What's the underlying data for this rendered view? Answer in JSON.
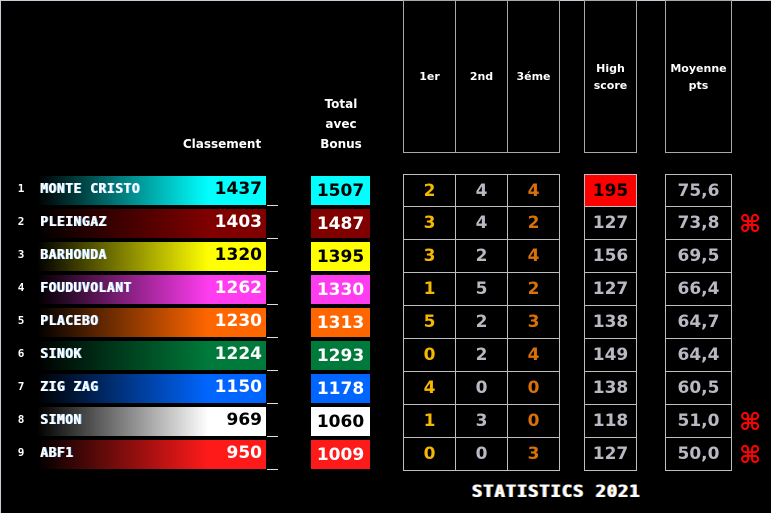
{
  "headers": {
    "classement": "Classement",
    "total_line1": "Total",
    "total_line2": "avec",
    "total_line3": "Bonus",
    "first": "1er",
    "second": "2nd",
    "third": "3éme",
    "highscore_line1": "High",
    "highscore_line2": "score",
    "moyenne_line1": "Moyenne",
    "moyenne_line2": "pts"
  },
  "players": [
    {
      "rank": "1",
      "name": "MONTE CRISTO",
      "score": "1437",
      "total": "1507",
      "first": "2",
      "second": "4",
      "third": "4",
      "highscore": "195",
      "average": "75,6",
      "mark": "",
      "color": "#00ffff",
      "text_color": "#000000",
      "top_highscore": true
    },
    {
      "rank": "2",
      "name": "PLEINGAZ",
      "score": "1403",
      "total": "1487",
      "first": "3",
      "second": "4",
      "third": "2",
      "highscore": "127",
      "average": "73,8",
      "mark": "⌘",
      "color": "#800000",
      "text_color": "#ffffff",
      "top_highscore": false
    },
    {
      "rank": "3",
      "name": "BARHONDA",
      "score": "1320",
      "total": "1395",
      "first": "3",
      "second": "2",
      "third": "4",
      "highscore": "156",
      "average": "69,5",
      "mark": "",
      "color": "#ffff00",
      "text_color": "#000000",
      "top_highscore": false
    },
    {
      "rank": "4",
      "name": "FOUDUVOLANT",
      "score": "1262",
      "total": "1330",
      "first": "1",
      "second": "5",
      "third": "2",
      "highscore": "127",
      "average": "66,4",
      "mark": "",
      "color": "#ff3cf0",
      "text_color": "#ffffff",
      "top_highscore": false
    },
    {
      "rank": "5",
      "name": "PLACEBO",
      "score": "1230",
      "total": "1313",
      "first": "5",
      "second": "2",
      "third": "3",
      "highscore": "138",
      "average": "64,7",
      "mark": "",
      "color": "#ff6600",
      "text_color": "#ffffff",
      "top_highscore": false
    },
    {
      "rank": "6",
      "name": "SINOK",
      "score": "1224",
      "total": "1293",
      "first": "0",
      "second": "2",
      "third": "4",
      "highscore": "149",
      "average": "64,4",
      "mark": "",
      "color": "#007a3a",
      "text_color": "#ffffff",
      "top_highscore": false
    },
    {
      "rank": "7",
      "name": "ZIG ZAG",
      "score": "1150",
      "total": "1178",
      "first": "4",
      "second": "0",
      "third": "0",
      "highscore": "138",
      "average": "60,5",
      "mark": "",
      "color": "#0066ff",
      "text_color": "#ffffff",
      "top_highscore": false
    },
    {
      "rank": "8",
      "name": "SIMON",
      "score": "969",
      "total": "1060",
      "first": "1",
      "second": "3",
      "third": "0",
      "highscore": "118",
      "average": "51,0",
      "mark": "⌘",
      "color": "#ffffff",
      "text_color": "#000000",
      "top_highscore": false
    },
    {
      "rank": "9",
      "name": "ABF1",
      "score": "950",
      "total": "1009",
      "first": "0",
      "second": "0",
      "third": "3",
      "highscore": "127",
      "average": "50,0",
      "mark": "⌘",
      "color": "#ff1a1a",
      "text_color": "#ffffff",
      "top_highscore": false
    }
  ],
  "footer": {
    "title": "STATISTICS 2021"
  }
}
